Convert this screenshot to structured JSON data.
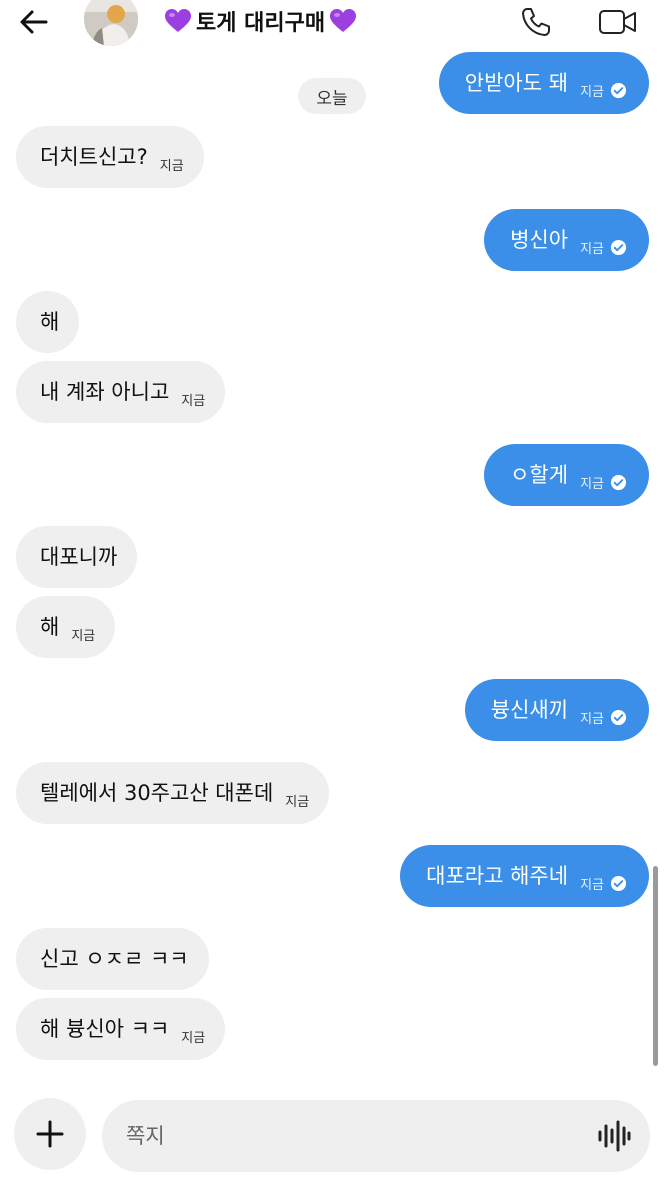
{
  "header": {
    "title": "토게 대리구매",
    "heart_color": "#9b3fe0"
  },
  "date_divider": "오늘",
  "messages": [
    {
      "dir": "out",
      "text": "안받아도 돼",
      "time": "지금",
      "seen": true
    },
    {
      "dir": "in",
      "text": "더치트신고?",
      "time": "지금"
    },
    {
      "dir": "out",
      "text": "병신아",
      "time": "지금",
      "seen": true
    },
    {
      "dir": "in",
      "text": "해",
      "time": ""
    },
    {
      "dir": "in",
      "text": "내 계좌 아니고",
      "time": "지금"
    },
    {
      "dir": "out",
      "text": "ㅇ할게",
      "time": "지금",
      "seen": true
    },
    {
      "dir": "in",
      "text": "대포니까",
      "time": ""
    },
    {
      "dir": "in",
      "text": "해",
      "time": "지금"
    },
    {
      "dir": "out",
      "text": "븅신새끼",
      "time": "지금",
      "seen": true
    },
    {
      "dir": "in",
      "text": "텔레에서 30주고산 대폰데",
      "time": "지금"
    },
    {
      "dir": "out",
      "text": "대포라고 해주네",
      "time": "지금",
      "seen": true
    },
    {
      "dir": "in",
      "text": "신고 ㅇㅈㄹ ㅋㅋ",
      "time": ""
    },
    {
      "dir": "in",
      "text": "해 븅신아 ㅋㅋ",
      "time": "지금"
    }
  ],
  "composer": {
    "placeholder": "쪽지"
  },
  "colors": {
    "outgoing_bubble": "#3b8fe8",
    "incoming_bubble": "#efeff0"
  },
  "icons": {
    "back": "arrow-left-icon",
    "call": "phone-icon",
    "video": "video-camera-icon",
    "add": "plus-icon",
    "voice": "audio-wave-icon",
    "seen": "check-circle-icon"
  }
}
